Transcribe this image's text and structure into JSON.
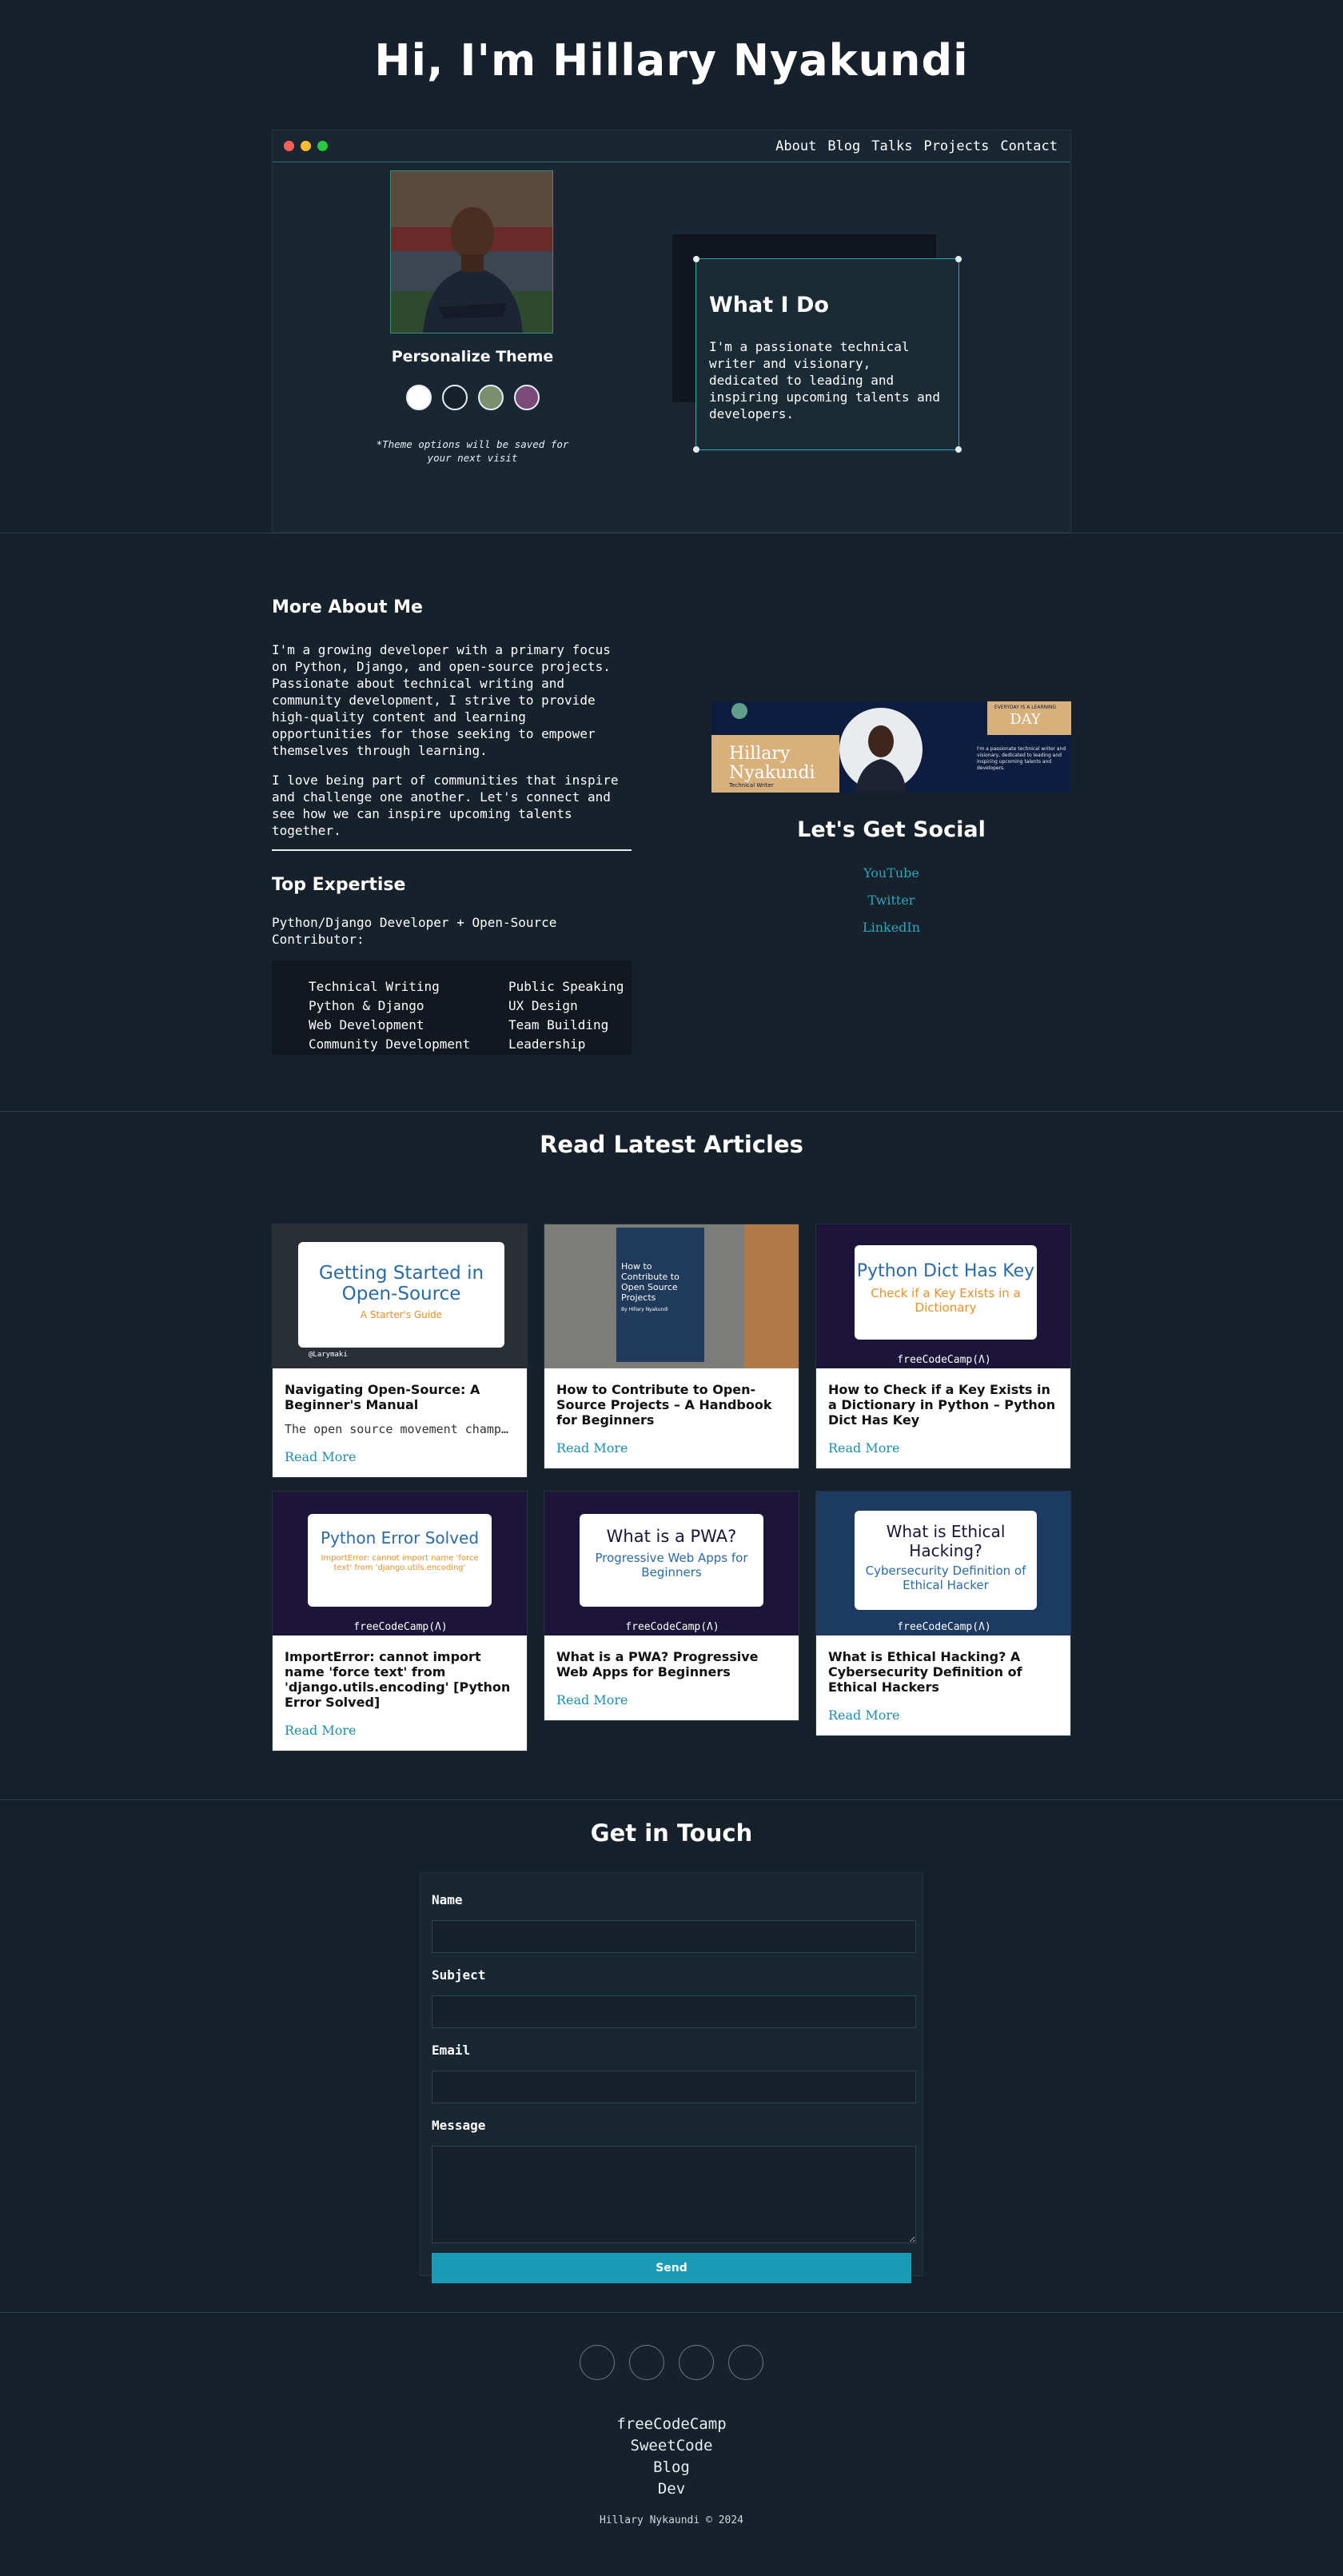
{
  "header": {
    "title": "Hi, I'm Hillary Nyakundi"
  },
  "nav": {
    "items": [
      "About",
      "Blog",
      "Talks",
      "Projects",
      "Contact"
    ]
  },
  "window": {
    "dots": [
      "#ff5f57",
      "#febc2e",
      "#28c840"
    ]
  },
  "theme": {
    "title": "Personalize Theme",
    "swatches": [
      "#ffffff",
      "#17212b",
      "#7a8f6e",
      "#7b4a78"
    ],
    "note": "*Theme options will be saved for your next visit"
  },
  "what_i_do": {
    "title": "What I Do",
    "text": "I'm a passionate technical writer and visionary, dedicated to leading and inspiring upcoming talents and developers."
  },
  "about": {
    "title": "More About Me",
    "p1": "I'm a growing developer with a primary focus on Python, Django, and open-source projects. Passionate about technical writing and community development, I strive to provide high-quality content and learning opportunities for those seeking to empower themselves through learning.",
    "p2": "I love being part of communities that inspire and challenge one another. Let's connect and see how we can inspire upcoming talents together.",
    "expertise_title": "Top Expertise",
    "expertise_sub": "Python/Django Developer + Open-Source Contributor:",
    "expertise": [
      "Technical Writing",
      "Public Speaking",
      "Python & Django",
      "UX Design",
      "Web Development",
      "Team Building",
      "Community Development",
      "Leadership"
    ]
  },
  "banner": {
    "name1": "Hillary",
    "name2": "Nyakundi",
    "role": "Technical Writer",
    "day": "DAY",
    "day_sub": "EVERYDAY IS A LEARNING",
    "blurb": "I'm a passionate technical writer and visionary, dedicated to leading and inspiring upcoming talents and developers."
  },
  "social": {
    "title": "Let's Get Social",
    "links": [
      "YouTube",
      "Twitter",
      "LinkedIn"
    ]
  },
  "articles": {
    "title": "Read Latest Articles",
    "read_more": "Read More",
    "items": [
      {
        "title": "Navigating Open-Source: A Beginner's Manual",
        "excerpt": "The open source movement champions transparency and collaboration",
        "thumb_title": "Getting Started in Open-Source",
        "thumb_sub": "A Starter's Guide"
      },
      {
        "title": "How to Contribute to Open-Source Projects – A Handbook for Beginners",
        "excerpt": "",
        "thumb_title": "How to Contribute to Open Source Projects",
        "thumb_sub": "By Hillary Nyakundi"
      },
      {
        "title": "How to Check if a Key Exists in a Dictionary in Python – Python Dict Has Key",
        "excerpt": "",
        "thumb_title": "Python Dict Has Key",
        "thumb_sub": "Check if a Key Exists in a Dictionary"
      },
      {
        "title": "ImportError: cannot import name 'force text' from 'django.utils.encoding' [Python Error Solved]",
        "excerpt": "",
        "thumb_title": "Python Error Solved",
        "thumb_sub": "ImportError: cannot import name 'force text' from 'django.utils.encoding'"
      },
      {
        "title": "What is a PWA? Progressive Web Apps for Beginners",
        "excerpt": "",
        "thumb_title": "What is a PWA?",
        "thumb_sub": "Progressive Web Apps for Beginners"
      },
      {
        "title": "What is Ethical Hacking? A Cybersecurity Definition of Ethical Hackers",
        "excerpt": "",
        "thumb_title": "What is Ethical Hacking?",
        "thumb_sub": "Cybersecurity Definition of Ethical Hacker"
      }
    ],
    "fcc": "freeCodeCamp(Ʌ)",
    "handle": "@Larymaki"
  },
  "contact": {
    "title": "Get in Touch",
    "fields": [
      "Name",
      "Subject",
      "Email",
      "Message"
    ],
    "send": "Send"
  },
  "footer": {
    "icons": [
      "instagram-icon",
      "linkedin-icon",
      "twitter-icon",
      "facebook-icon"
    ],
    "links": [
      "freeCodeCamp",
      "SweetCode",
      "Blog",
      "Dev"
    ],
    "copyright": "Hillary Nykaundi © 2024"
  }
}
